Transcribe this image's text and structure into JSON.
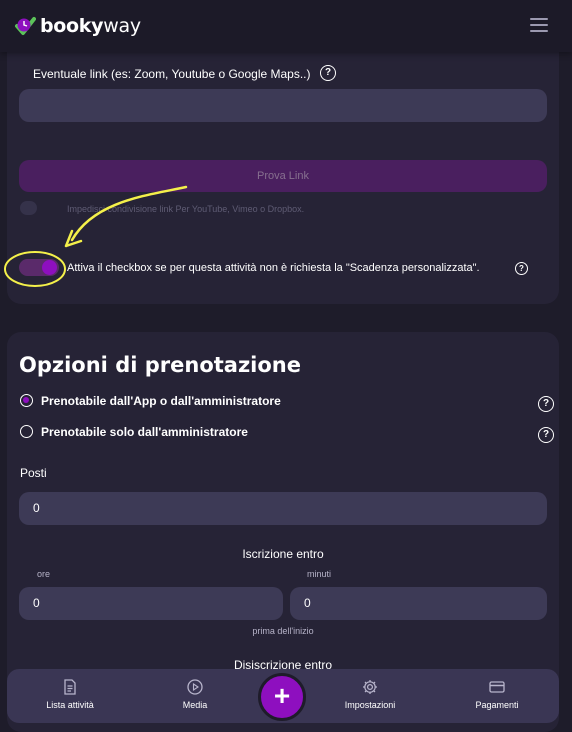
{
  "brand": {
    "logo_text_bold": "booky",
    "logo_text_light": "way"
  },
  "link_section": {
    "label": "Eventuale link (es: Zoom, Youtube o Google Maps..)",
    "help_icon": "?",
    "link_value": "",
    "test_button": "Prova Link",
    "prevent_share_text": "Impedisci condivisione link Per YouTube, Vimeo o Dropbox.",
    "custom_deadline_text": "Attiva il checkbox se per questa attività non è richiesta la \"Scadenza personalizzata\".",
    "custom_deadline_enabled": true
  },
  "booking_options": {
    "title": "Opzioni di prenotazione",
    "options": [
      {
        "label": "Prenotabile dall'App o dall'amministratore",
        "selected": true
      },
      {
        "label": "Prenotabile solo dall'amministratore",
        "selected": false
      }
    ],
    "help_icon": "?",
    "seats_label": "Posti",
    "seats_value": "0",
    "signup_title": "Iscrizione entro",
    "hours_label": "ore",
    "minutes_label": "minuti",
    "signup_hours": "0",
    "signup_minutes": "0",
    "before_start": "prima dell'inizio",
    "cancel_title": "Disiscrizione entro"
  },
  "bottom_nav": {
    "items": [
      {
        "label": "Lista attività",
        "icon": "document-icon"
      },
      {
        "label": "Media",
        "icon": "play-circle-icon"
      },
      {
        "label": "Impostazioni",
        "icon": "gear-icon"
      },
      {
        "label": "Pagamenti",
        "icon": "credit-card-icon"
      }
    ],
    "add_label": "+"
  },
  "colors": {
    "accent": "#8e0fbf",
    "background": "#1e1c2a",
    "card": "#262336",
    "input": "#3d3a56",
    "annotation": "#f4f04a"
  }
}
